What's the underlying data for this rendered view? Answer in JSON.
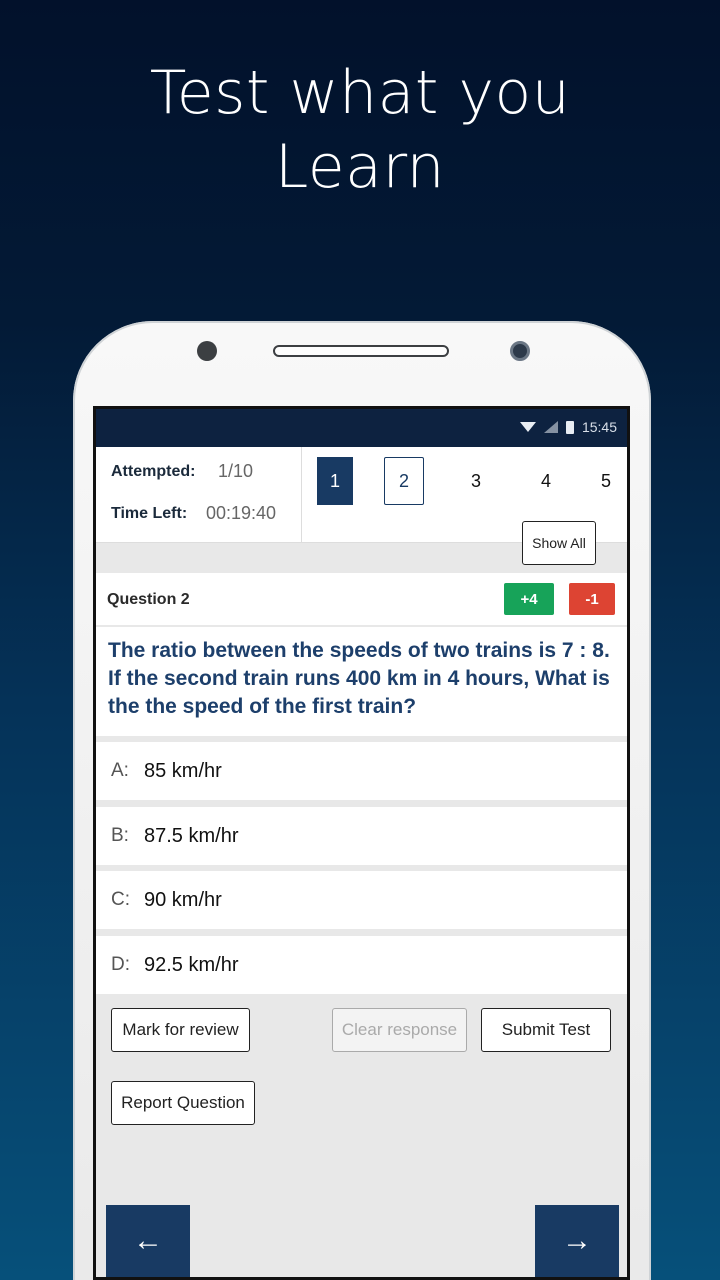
{
  "promo": {
    "line1": "Test what you",
    "line2": "Learn"
  },
  "status_bar": {
    "time": "15:45"
  },
  "stats": {
    "attempted_label": "Attempted:",
    "attempted_value": "1/10",
    "time_left_label": "Time Left:",
    "time_left_value": "00:19:40"
  },
  "question_nav": {
    "numbers": [
      "1",
      "2",
      "3",
      "4",
      "5"
    ],
    "show_all_label": "Show All"
  },
  "question": {
    "title": "Question 2",
    "positive_marks": "+4",
    "negative_marks": "-1",
    "text": "The ratio between the speeds of two trains is 7 : 8. If the second train runs 400 km in 4 hours, What is the the speed of the first train?"
  },
  "options": [
    {
      "letter": "A:",
      "text": "85 km/hr"
    },
    {
      "letter": "B:",
      "text": "87.5 km/hr"
    },
    {
      "letter": "C:",
      "text": "90 km/hr"
    },
    {
      "letter": "D:",
      "text": "92.5 km/hr"
    }
  ],
  "actions": {
    "mark_for_review": "Mark for review",
    "clear_response": "Clear response",
    "submit_test": "Submit Test",
    "report_question": "Report Question"
  },
  "navigation": {
    "prev": "←",
    "next": "→"
  },
  "colors": {
    "primary": "#183a63",
    "positive": "#17a359",
    "negative": "#dd4433"
  }
}
